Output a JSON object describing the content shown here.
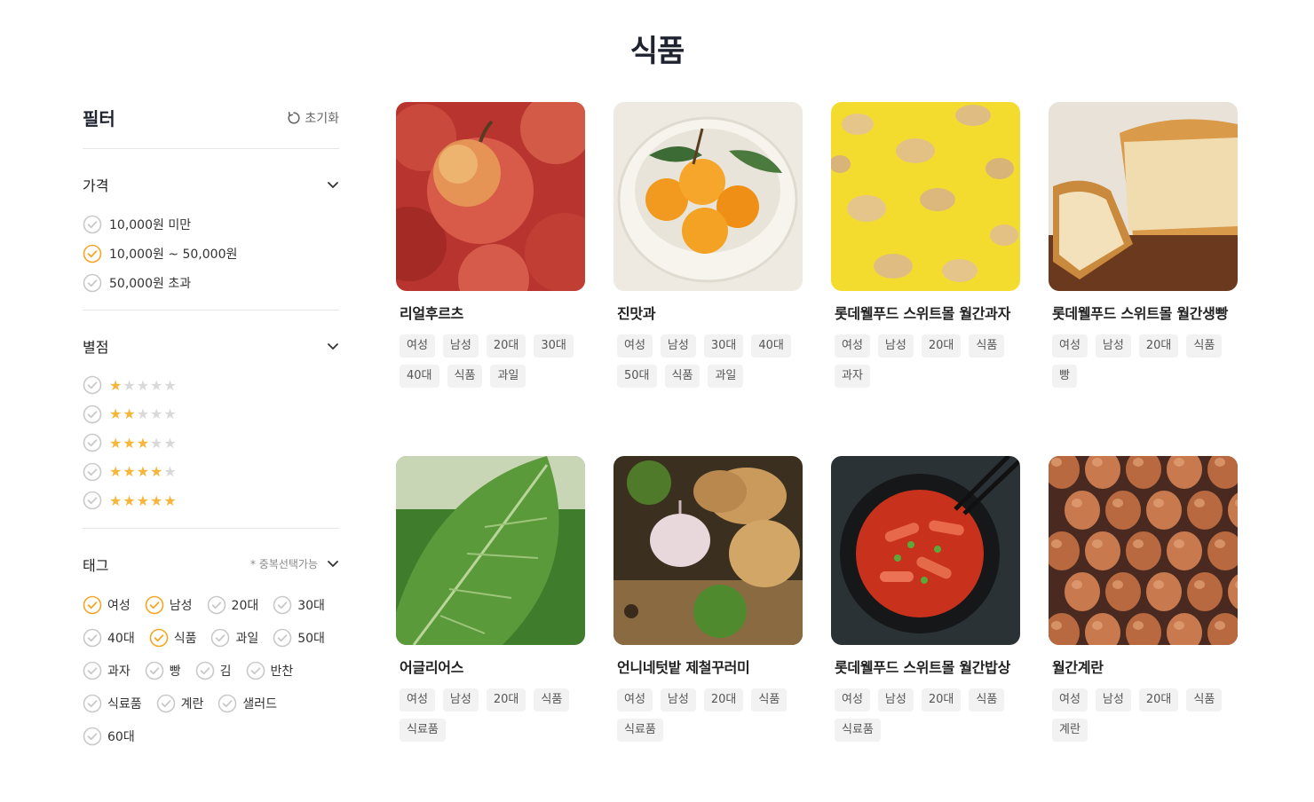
{
  "page": {
    "title": "식품"
  },
  "sidebar": {
    "title": "필터",
    "reset_label": "초기화",
    "price": {
      "title": "가격",
      "options": [
        {
          "label": "10,000원 미만",
          "checked": false
        },
        {
          "label": "10,000원 ~ 50,000원",
          "checked": true
        },
        {
          "label": "50,000원 초과",
          "checked": false
        }
      ]
    },
    "rating": {
      "title": "별점",
      "options": [
        {
          "stars": 1,
          "checked": false
        },
        {
          "stars": 2,
          "checked": false
        },
        {
          "stars": 3,
          "checked": false
        },
        {
          "stars": 4,
          "checked": false
        },
        {
          "stars": 5,
          "checked": false
        }
      ]
    },
    "tags": {
      "title": "태그",
      "note": "* 중복선택가능",
      "options": [
        {
          "label": "여성",
          "checked": true
        },
        {
          "label": "남성",
          "checked": true
        },
        {
          "label": "20대",
          "checked": false
        },
        {
          "label": "30대",
          "checked": false
        },
        {
          "label": "40대",
          "checked": false
        },
        {
          "label": "식품",
          "checked": true
        },
        {
          "label": "과일",
          "checked": false
        },
        {
          "label": "50대",
          "checked": false
        },
        {
          "label": "과자",
          "checked": false
        },
        {
          "label": "빵",
          "checked": false
        },
        {
          "label": "김",
          "checked": false
        },
        {
          "label": "반찬",
          "checked": false
        },
        {
          "label": "식료품",
          "checked": false
        },
        {
          "label": "계란",
          "checked": false
        },
        {
          "label": "샐러드",
          "checked": false
        },
        {
          "label": "60대",
          "checked": false
        }
      ]
    }
  },
  "colors": {
    "accent": "#f6a623",
    "star_on": "#f6b63a",
    "star_off": "#d9d9d9",
    "chip_bg": "#f2f2f2"
  },
  "products": [
    {
      "name": "리얼후르츠",
      "image": "red-apples-photo",
      "tags": [
        "여성",
        "남성",
        "20대",
        "30대",
        "40대",
        "식품",
        "과일"
      ]
    },
    {
      "name": "진맛과",
      "image": "persimmons-in-bowl-photo",
      "tags": [
        "여성",
        "남성",
        "30대",
        "40대",
        "50대",
        "식품",
        "과일"
      ]
    },
    {
      "name": "롯데웰푸드 스위트몰 월간과자",
      "image": "potato-chips-on-yellow-photo",
      "tags": [
        "여성",
        "남성",
        "20대",
        "식품",
        "과자"
      ]
    },
    {
      "name": "롯데웰푸드 스위트몰 월간생빵",
      "image": "sliced-bread-loaf-photo",
      "tags": [
        "여성",
        "남성",
        "20대",
        "식품",
        "빵"
      ]
    },
    {
      "name": "어글리어스",
      "image": "green-leaf-photo",
      "tags": [
        "여성",
        "남성",
        "20대",
        "식품",
        "식료품"
      ]
    },
    {
      "name": "언니네텃밭 제철꾸러미",
      "image": "potatoes-garlic-herbs-photo",
      "tags": [
        "여성",
        "남성",
        "20대",
        "식품",
        "식료품"
      ]
    },
    {
      "name": "롯데웰푸드 스위트몰 월간밥상",
      "image": "tteokbokki-in-pot-photo",
      "tags": [
        "여성",
        "남성",
        "20대",
        "식품",
        "식료품"
      ]
    },
    {
      "name": "월간계란",
      "image": "brown-eggs-tray-photo",
      "tags": [
        "여성",
        "남성",
        "20대",
        "식품",
        "계란"
      ]
    }
  ]
}
